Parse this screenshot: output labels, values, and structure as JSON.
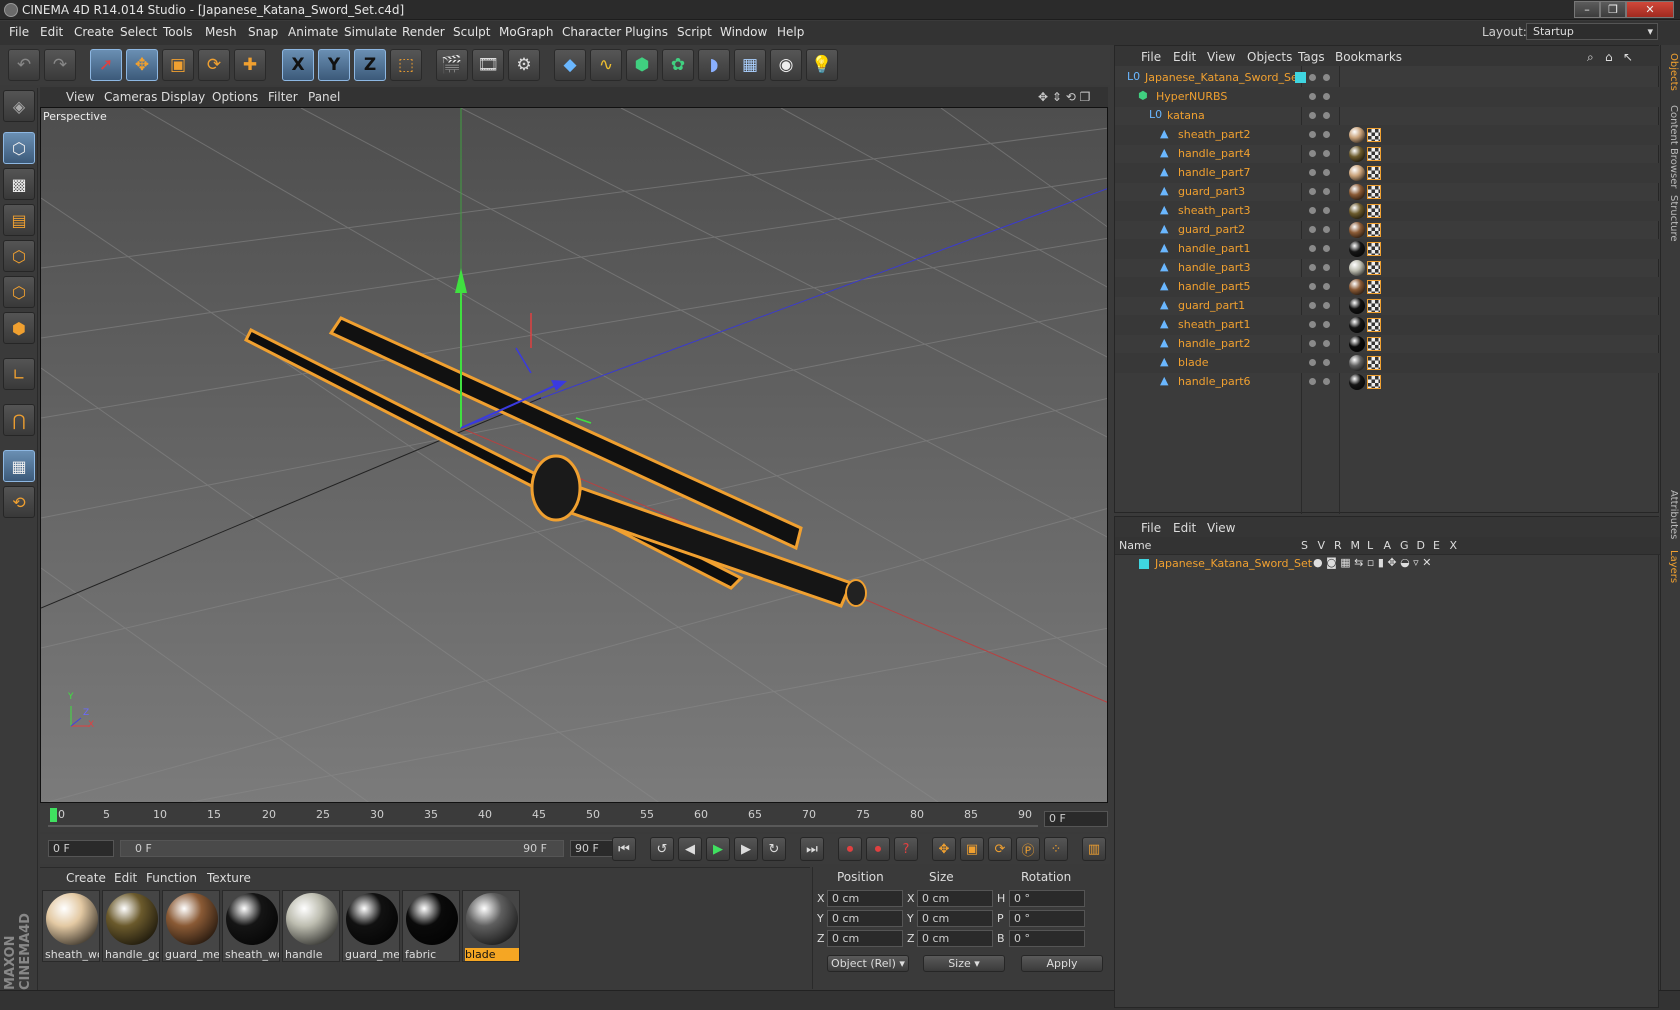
{
  "window": {
    "title": "CINEMA 4D R14.014 Studio - [Japanese_Katana_Sword_Set.c4d]"
  },
  "menubar": {
    "items": [
      "File",
      "Edit",
      "Create",
      "Select",
      "Tools",
      "Mesh",
      "Snap",
      "Animate",
      "Simulate",
      "Render",
      "Sculpt",
      "MoGraph",
      "Character",
      "Plugins",
      "Script",
      "Window",
      "Help"
    ],
    "layout_label": "Layout:",
    "layout_value": "Startup"
  },
  "toolbar": {
    "icons": [
      "undo-icon",
      "redo-icon",
      "select-live-icon",
      "move-icon",
      "scale-icon",
      "rotate-icon",
      "move-alt-icon",
      "x-axis-icon",
      "y-axis-icon",
      "z-axis-icon",
      "coordinate-system-icon",
      "render-view-icon",
      "render-picture-viewer-icon",
      "render-settings-icon",
      "cube-primitive-icon",
      "spline-icon",
      "nurbs-icon",
      "mograph-cloner-icon",
      "deformer-icon",
      "floor-icon",
      "camera-icon",
      "light-icon"
    ],
    "axis_labels": [
      "X",
      "Y",
      "Z"
    ]
  },
  "viewport": {
    "menu": [
      "View",
      "Cameras",
      "Display",
      "Options",
      "Filter",
      "Panel"
    ],
    "label": "Perspective",
    "axis_labels": [
      "Y",
      "Z",
      "X"
    ]
  },
  "timeline": {
    "ticks": [
      "0",
      "5",
      "10",
      "15",
      "20",
      "25",
      "30",
      "35",
      "40",
      "45",
      "50",
      "55",
      "60",
      "65",
      "70",
      "75",
      "80",
      "85",
      "90"
    ],
    "current_frame": "0 F"
  },
  "transport": {
    "start_frame": "0 F",
    "range_start": "0 F",
    "range_end": "90 F",
    "end_frame": "90 F"
  },
  "materials": {
    "menu": [
      "Create",
      "Edit",
      "Function",
      "Texture"
    ],
    "items": [
      {
        "name": "sheath_wo",
        "color": "#e3c9a3"
      },
      {
        "name": "handle_go",
        "color": "#6b5a2c"
      },
      {
        "name": "guard_met",
        "color": "#8a5a35"
      },
      {
        "name": "sheath_wo",
        "color": "#151515"
      },
      {
        "name": "handle",
        "color": "#bdbdb0"
      },
      {
        "name": "guard_met",
        "color": "#111111"
      },
      {
        "name": "fabric",
        "color": "#0a0a0a"
      },
      {
        "name": "blade",
        "color": "#5f5f5f"
      }
    ],
    "selected_index": 7
  },
  "coordinates": {
    "headers": [
      "Position",
      "Size",
      "Rotation"
    ],
    "rows": [
      {
        "axis": "X",
        "position": "0 cm",
        "size_axis": "X",
        "size": "0 cm",
        "rot_axis": "H",
        "rotation": "0 °"
      },
      {
        "axis": "Y",
        "position": "0 cm",
        "size_axis": "Y",
        "size": "0 cm",
        "rot_axis": "P",
        "rotation": "0 °"
      },
      {
        "axis": "Z",
        "position": "0 cm",
        "size_axis": "Z",
        "size": "0 cm",
        "rot_axis": "B",
        "rotation": "0 °"
      }
    ],
    "mode_select": "Object (Rel)",
    "size_select": "Size",
    "apply_label": "Apply"
  },
  "branding": {
    "logo": "MAXON CINEMA4D"
  },
  "objects_panel": {
    "menu": [
      "File",
      "Edit",
      "View",
      "Objects",
      "Tags",
      "Bookmarks"
    ],
    "tree": [
      {
        "name": "Japanese_Katana_Sword_Set",
        "icon": "null-object-icon",
        "depth": 0,
        "tag_color": "#3fd5e0"
      },
      {
        "name": "HyperNURBS",
        "icon": "hypernurbs-icon",
        "depth": 1
      },
      {
        "name": "katana",
        "icon": "null-object-icon",
        "depth": 2
      },
      {
        "name": "sheath_part2",
        "icon": "polygon-object-icon",
        "depth": 3,
        "mat": "#c9a27a"
      },
      {
        "name": "handle_part4",
        "icon": "polygon-object-icon",
        "depth": 3,
        "mat": "#6b5a2c"
      },
      {
        "name": "handle_part7",
        "icon": "polygon-object-icon",
        "depth": 3,
        "mat": "#c9a27a"
      },
      {
        "name": "guard_part3",
        "icon": "polygon-object-icon",
        "depth": 3,
        "mat": "#8a5a35"
      },
      {
        "name": "sheath_part3",
        "icon": "polygon-object-icon",
        "depth": 3,
        "mat": "#6b5a2c"
      },
      {
        "name": "guard_part2",
        "icon": "polygon-object-icon",
        "depth": 3,
        "mat": "#8a5a35"
      },
      {
        "name": "handle_part1",
        "icon": "polygon-object-icon",
        "depth": 3,
        "mat": "#151515"
      },
      {
        "name": "handle_part3",
        "icon": "polygon-object-icon",
        "depth": 3,
        "mat": "#bdbdb0"
      },
      {
        "name": "handle_part5",
        "icon": "polygon-object-icon",
        "depth": 3,
        "mat": "#8a5a35"
      },
      {
        "name": "guard_part1",
        "icon": "polygon-object-icon",
        "depth": 3,
        "mat": "#111111"
      },
      {
        "name": "sheath_part1",
        "icon": "polygon-object-icon",
        "depth": 3,
        "mat": "#151515"
      },
      {
        "name": "handle_part2",
        "icon": "polygon-object-icon",
        "depth": 3,
        "mat": "#0a0a0a"
      },
      {
        "name": "blade",
        "icon": "polygon-object-icon",
        "depth": 3,
        "mat": "#5f5f5f"
      },
      {
        "name": "handle_part6",
        "icon": "polygon-object-icon",
        "depth": 3,
        "mat": "#151515"
      }
    ]
  },
  "layers_panel": {
    "menu": [
      "File",
      "Edit",
      "View"
    ],
    "columns": [
      "Name",
      "S",
      "V",
      "R",
      "M",
      "L",
      "A",
      "G",
      "D",
      "E",
      "X"
    ],
    "rows": [
      {
        "name": "Japanese_Katana_Sword_Set",
        "color": "#3fd5e0"
      }
    ]
  },
  "side_tabs": [
    "Objects",
    "Content Browser",
    "Structure",
    "Attributes",
    "Layers"
  ],
  "colors": {
    "accent": "#f0a030",
    "selection": "#f5a623",
    "layer": "#3fd5e0"
  }
}
